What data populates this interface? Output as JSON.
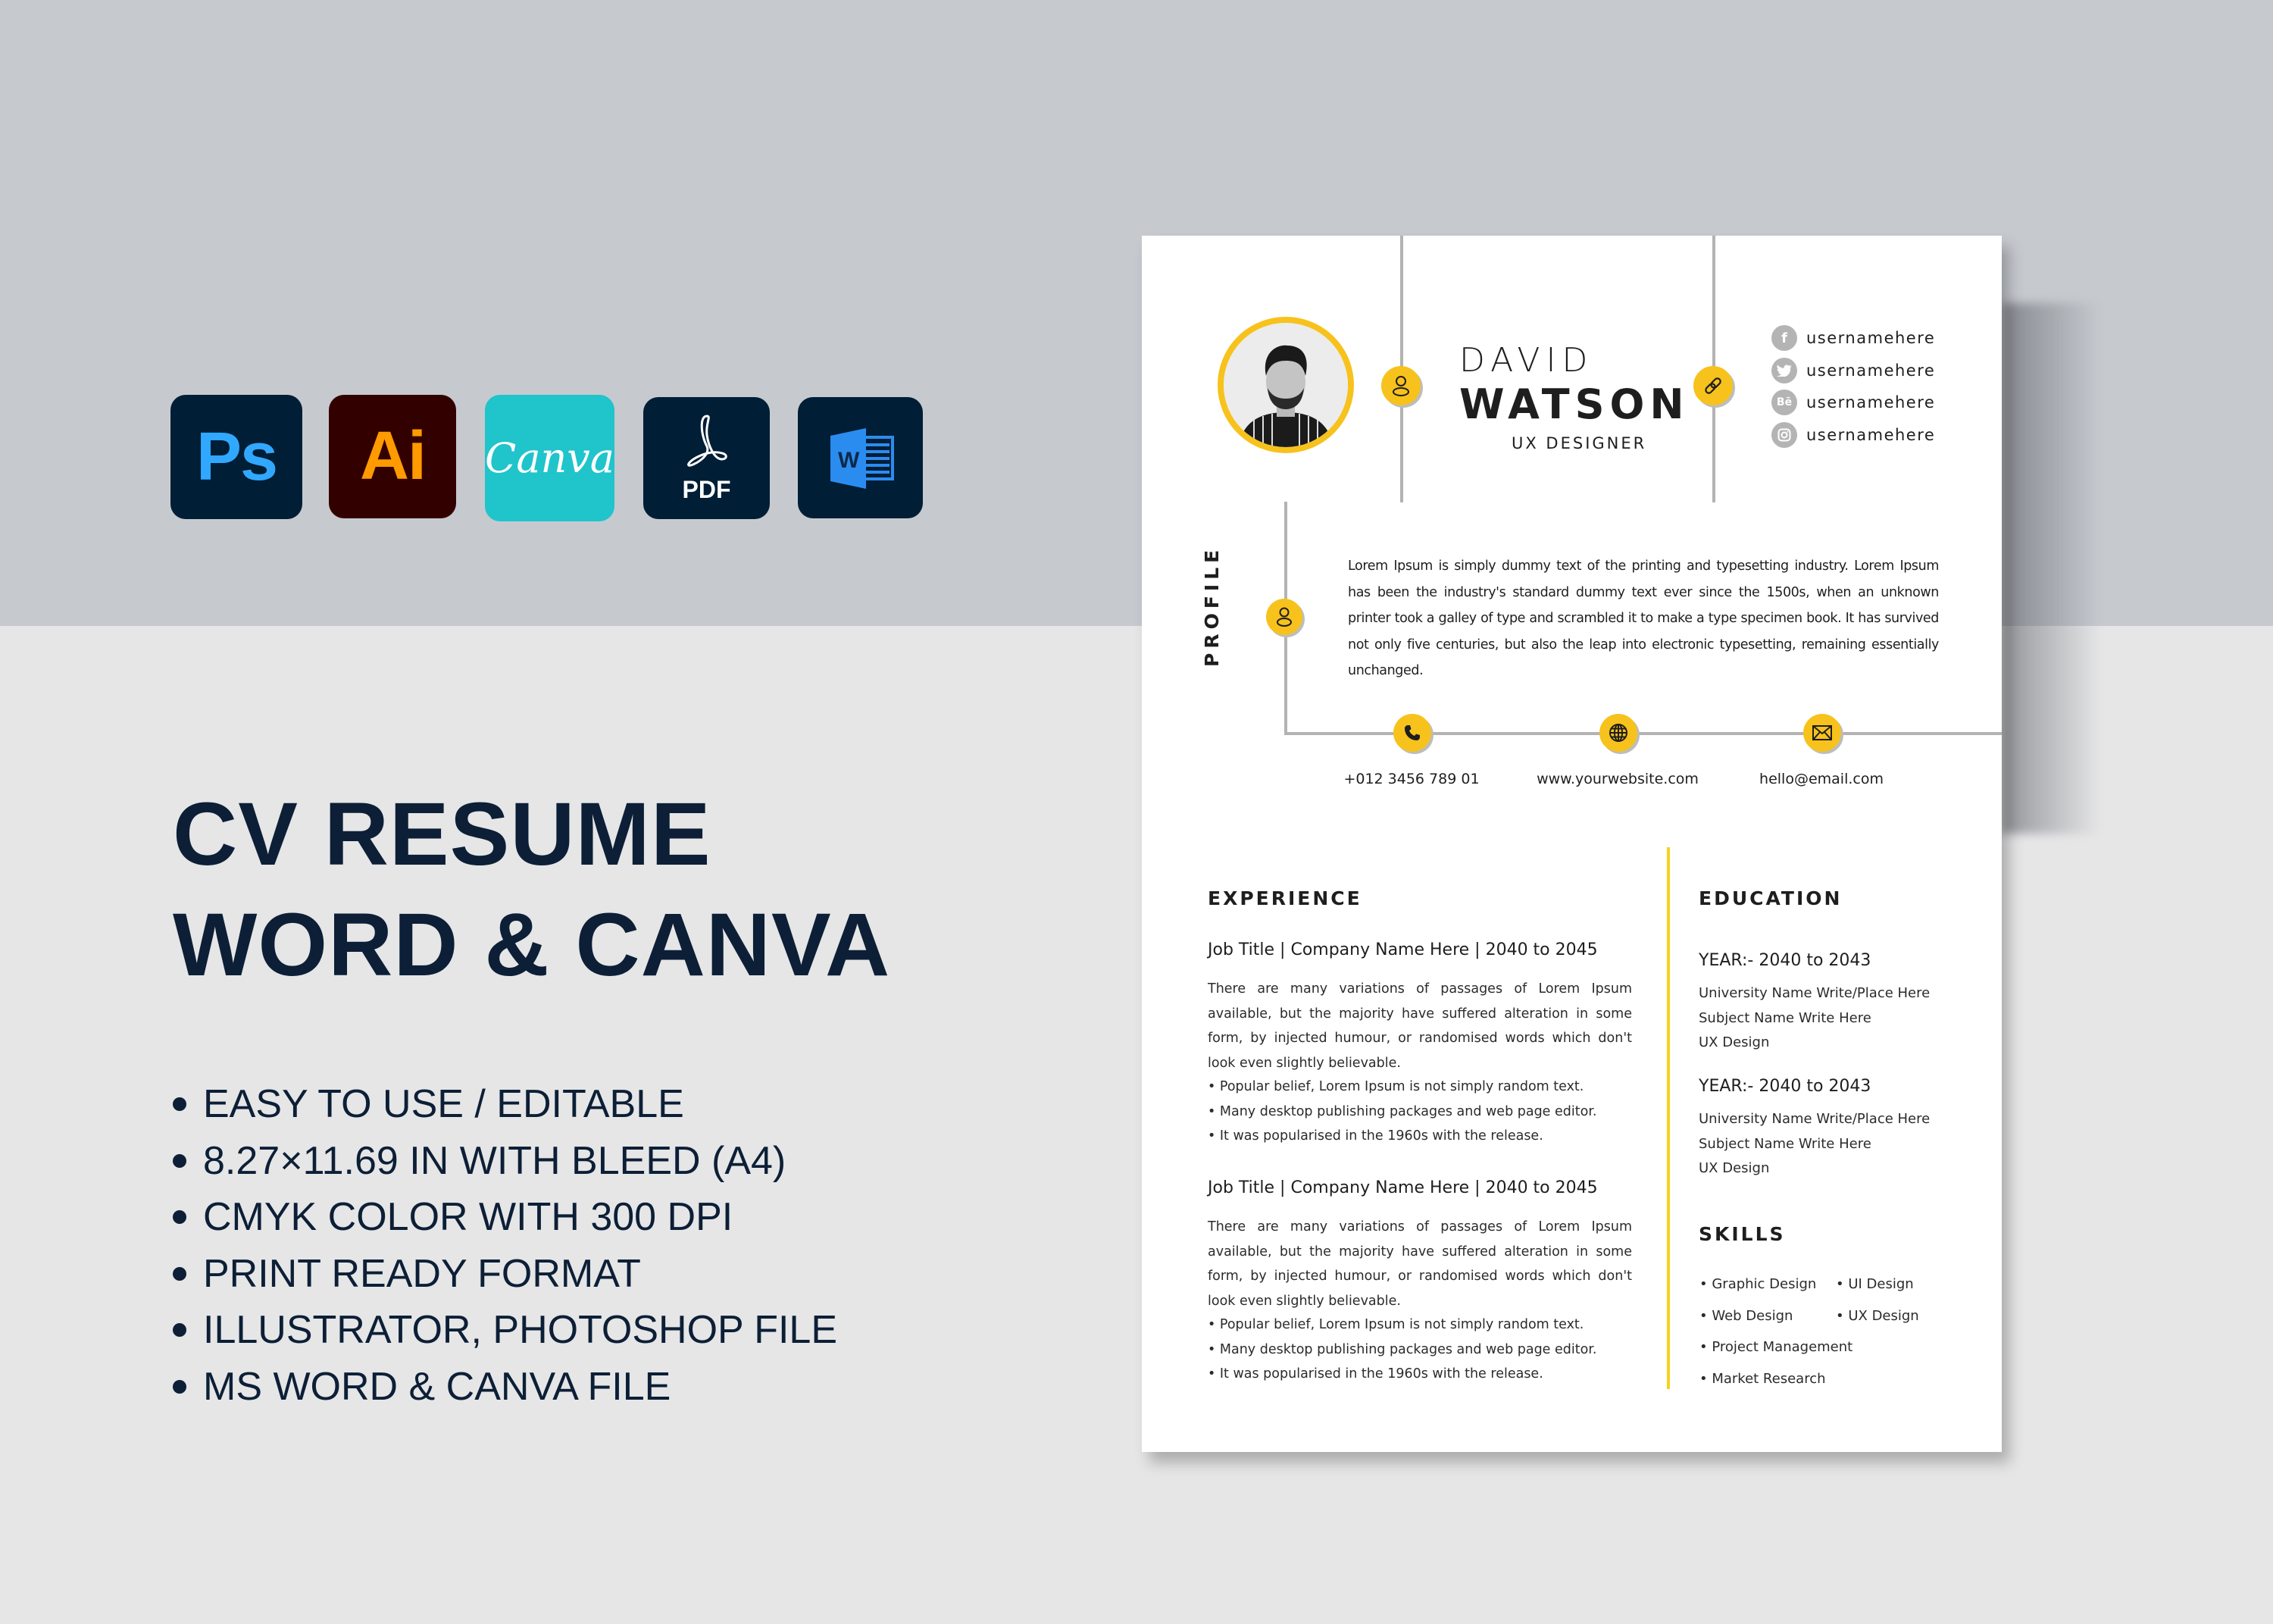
{
  "apps": [
    {
      "name": "Photoshop",
      "label": "Ps",
      "bg": "#001e36",
      "fg": "#31a8ff"
    },
    {
      "name": "Illustrator",
      "label": "Ai",
      "bg": "#330000",
      "fg": "#ff9a00"
    },
    {
      "name": "Canva",
      "label": "Canva",
      "bg": "#20c4cb",
      "fg": "#ffffff"
    },
    {
      "name": "PDF",
      "label": "PDF",
      "bg": "#001e36",
      "fg": "#ffffff"
    },
    {
      "name": "Word",
      "label": "W",
      "bg": "#001e36",
      "fg": "#2b8cf0"
    }
  ],
  "promo": {
    "headline_1": "CV RESUME",
    "headline_2": "WORD & CANVA",
    "features": [
      "EASY TO USE / EDITABLE",
      "8.27×11.69 IN WITH BLEED (A4)",
      "CMYK COLOR WITH 300 DPI",
      "PRINT READY FORMAT",
      "ILLUSTRATOR, PHOTOSHOP FILE",
      "MS WORD & CANVA FILE"
    ],
    "text_color": "#0c1f36"
  },
  "resume": {
    "accent_color": "#f7c21c",
    "first_name": "DAVID",
    "last_name": "WATSON",
    "role": "UX DESIGNER",
    "socials": [
      {
        "icon": "facebook-icon",
        "glyph": "f",
        "handle": "usernamehere"
      },
      {
        "icon": "twitter-icon",
        "glyph": "t",
        "handle": "usernamehere"
      },
      {
        "icon": "behance-icon",
        "glyph": "Bē",
        "handle": "usernamehere"
      },
      {
        "icon": "instagram-icon",
        "glyph": "◎",
        "handle": "usernamehere"
      }
    ],
    "profile": {
      "label": "PROFILE",
      "text": "Lorem Ipsum is simply dummy text of the printing and typesetting industry. Lorem Ipsum has been the industry's standard dummy text ever since the 1500s, when an unknown printer took a galley of type and scrambled it to make a type specimen book. It has survived not only five centuries, but also the leap into electronic typesetting, remaining essentially unchanged."
    },
    "contacts": {
      "phone": "+012 3456 789 01",
      "website": "www.yourwebsite.com",
      "email": "hello@email.com"
    },
    "experience": {
      "title": "EXPERIENCE",
      "jobs": [
        {
          "heading": "Job Title | Company Name Here | 2040 to 2045",
          "description": "There are many variations of passages of Lorem Ipsum available, but the majority have suffered alteration in some form, by injected humour, or randomised words which don't look even slightly believable.",
          "bullets": [
            "• Popular belief, Lorem Ipsum is not simply random text.",
            "• Many desktop publishing packages and web page editor.",
            "• It was popularised in the 1960s with the release."
          ]
        },
        {
          "heading": "Job Title | Company Name Here | 2040 to 2045",
          "description": "There are many variations of passages of Lorem Ipsum available, but the majority have suffered alteration in some form, by injected humour, or randomised words which don't look even slightly believable.",
          "bullets": [
            "• Popular belief, Lorem Ipsum is not simply random text.",
            "• Many desktop publishing packages and web page editor.",
            "• It was popularised in the 1960s with the release."
          ]
        }
      ]
    },
    "education": {
      "title": "EDUCATION",
      "entries": [
        {
          "year": "YEAR:- 2040 to 2043",
          "lines": [
            "University Name Write/Place Here",
            "Subject Name Write Here",
            "UX Design"
          ]
        },
        {
          "year": "YEAR:- 2040 to 2043",
          "lines": [
            "University Name Write/Place Here",
            "Subject Name Write Here",
            "UX Design"
          ]
        }
      ]
    },
    "skills": {
      "title": "SKILLS",
      "items": [
        "• Graphic Design",
        "• UI Design",
        "• Web Design",
        "• UX Design",
        "• Project Management",
        "",
        "• Market Research",
        ""
      ]
    }
  }
}
